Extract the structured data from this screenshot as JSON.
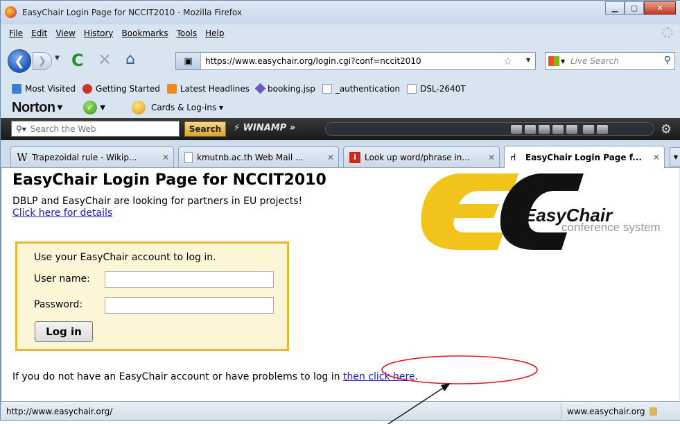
{
  "window": {
    "title": "EasyChair Login Page for NCCIT2010 - Mozilla Firefox"
  },
  "menu": [
    "File",
    "Edit",
    "View",
    "History",
    "Bookmarks",
    "Tools",
    "Help"
  ],
  "nav": {
    "url": "https://www.easychair.org/login.cgi?conf=nccit2010",
    "search_placeholder": "Live Search"
  },
  "bookmarks": [
    "Most Visited",
    "Getting Started",
    "Latest Headlines",
    "booking.jsp",
    "_authentication",
    "DSL-2640T"
  ],
  "norton": {
    "logo": "Norton",
    "cards": "Cards & Log-ins"
  },
  "winamp": {
    "search_placeholder": "Search the Web",
    "search_button": "Search",
    "brand": "WINAMP »"
  },
  "tabs": [
    {
      "label": "Trapezoidal rule - Wikip...",
      "icon": "W"
    },
    {
      "label": "kmutnb.ac.th Web Mail ...",
      "icon": ""
    },
    {
      "label": "Look up word/phrase in...",
      "icon": ""
    },
    {
      "label": "EasyChair Login Page f...",
      "icon": ""
    }
  ],
  "page": {
    "title": "EasyChair Login Page for NCCIT2010",
    "notice": "DBLP and EasyChair are looking for partners in EU projects!",
    "notice_link": "Click here for details",
    "login_intro": "Use your EasyChair account to log in.",
    "username_label": "User name:",
    "password_label": "Password:",
    "login_button": "Log in",
    "footer_text": "If you do not have an EasyChair account or have problems to log in ",
    "footer_link": "then click here",
    "footer_end": ".",
    "logo_name": "EasyChair",
    "logo_sub": "conference system",
    "logo_letters": "EC"
  },
  "status": {
    "left": "http://www.easychair.org/",
    "right": "www.easychair.org"
  },
  "colors": {
    "accent_yellow": "#f2c31b",
    "annotation_red": "#e8151a",
    "link": "#1a1acc"
  }
}
